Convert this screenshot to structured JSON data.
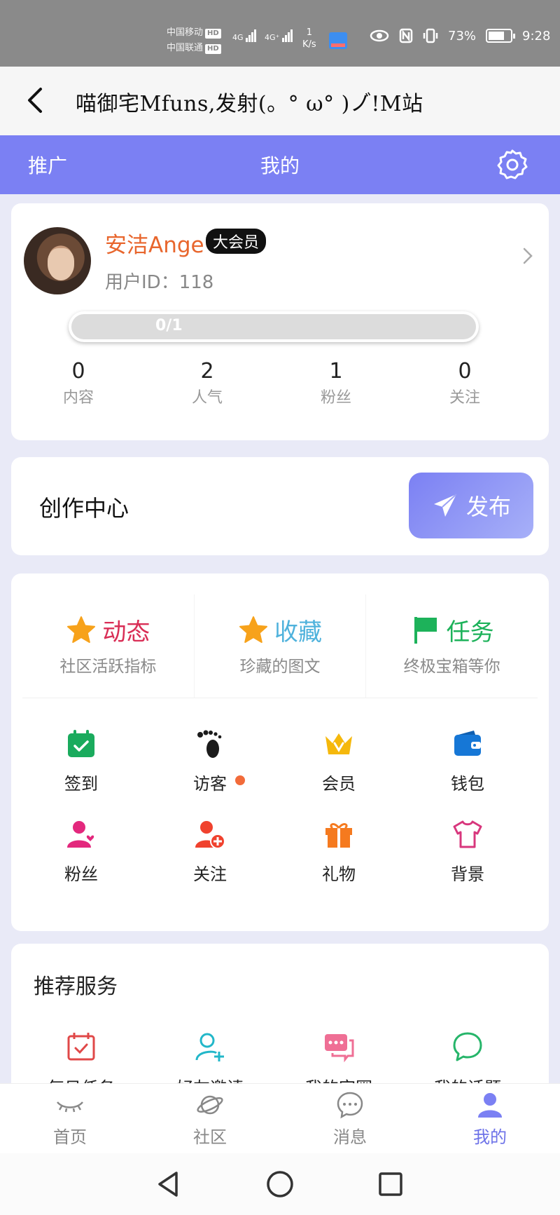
{
  "status_bar": {
    "carrier1": "中国移动",
    "carrier2": "中国联通",
    "hd": "HD",
    "net1": "4G",
    "net2": "4G⁺",
    "speed_value": "1",
    "speed_unit": "K/s",
    "battery": "73%",
    "time": "9:28"
  },
  "title_bar": {
    "title": "喵御宅Mfuns,发射(。° ω° )ノ゙!M站"
  },
  "header": {
    "left_tab": "推广",
    "center_title": "我的"
  },
  "profile": {
    "username": "安洁Ange",
    "badge": "大会员",
    "user_id_label": "用户ID：",
    "user_id": "118",
    "progress_text": "0/1",
    "progress_fraction": 0,
    "stats": [
      {
        "value": "0",
        "label": "内容"
      },
      {
        "value": "2",
        "label": "人气"
      },
      {
        "value": "1",
        "label": "粉丝"
      },
      {
        "value": "0",
        "label": "关注"
      }
    ]
  },
  "creation": {
    "title": "创作中心",
    "publish_label": "发布"
  },
  "features": [
    {
      "title": "动态",
      "subtitle": "社区活跃指标",
      "color": "#d92e56",
      "icon": "star-icon"
    },
    {
      "title": "收藏",
      "subtitle": "珍藏的图文",
      "color": "#4fb2dc",
      "icon": "star-icon"
    },
    {
      "title": "任务",
      "subtitle": "终极宝箱等你",
      "color": "#1db25a",
      "icon": "flag-icon"
    }
  ],
  "grid": [
    {
      "label": "签到",
      "icon": "calendar-check-icon",
      "color": "#1aab5d"
    },
    {
      "label": "访客",
      "icon": "footprint-icon",
      "color": "#1b1b1b"
    },
    {
      "label": "会员",
      "icon": "crown-icon",
      "color": "#f5b80c"
    },
    {
      "label": "钱包",
      "icon": "wallet-icon",
      "color": "#1677d6"
    },
    {
      "label": "粉丝",
      "icon": "user-heart-icon",
      "color": "#e3287d"
    },
    {
      "label": "关注",
      "icon": "user-add-icon",
      "color": "#f0422e"
    },
    {
      "label": "礼物",
      "icon": "gift-icon",
      "color": "#f57a1f"
    },
    {
      "label": "背景",
      "icon": "shirt-icon",
      "color": "#d8377d"
    }
  ],
  "recommend": {
    "title": "推荐服务",
    "items": [
      {
        "label": "每日任务",
        "icon": "calendar-check-icon",
        "color": "#e04848"
      },
      {
        "label": "好友邀请",
        "icon": "user-add-icon",
        "color": "#22b7c9"
      },
      {
        "label": "我的宅圈",
        "icon": "chat-bubbles-icon",
        "color": "#ef6f95"
      },
      {
        "label": "我的话题",
        "icon": "chat-bubble-icon",
        "color": "#26b56a"
      }
    ]
  },
  "bottom_nav": [
    {
      "label": "首页",
      "icon": "eye-closed-icon"
    },
    {
      "label": "社区",
      "icon": "planet-icon"
    },
    {
      "label": "消息",
      "icon": "message-icon"
    },
    {
      "label": "我的",
      "icon": "user-icon",
      "active": true
    }
  ],
  "colors": {
    "accent": "#7b80f3",
    "username": "#e8662d"
  }
}
